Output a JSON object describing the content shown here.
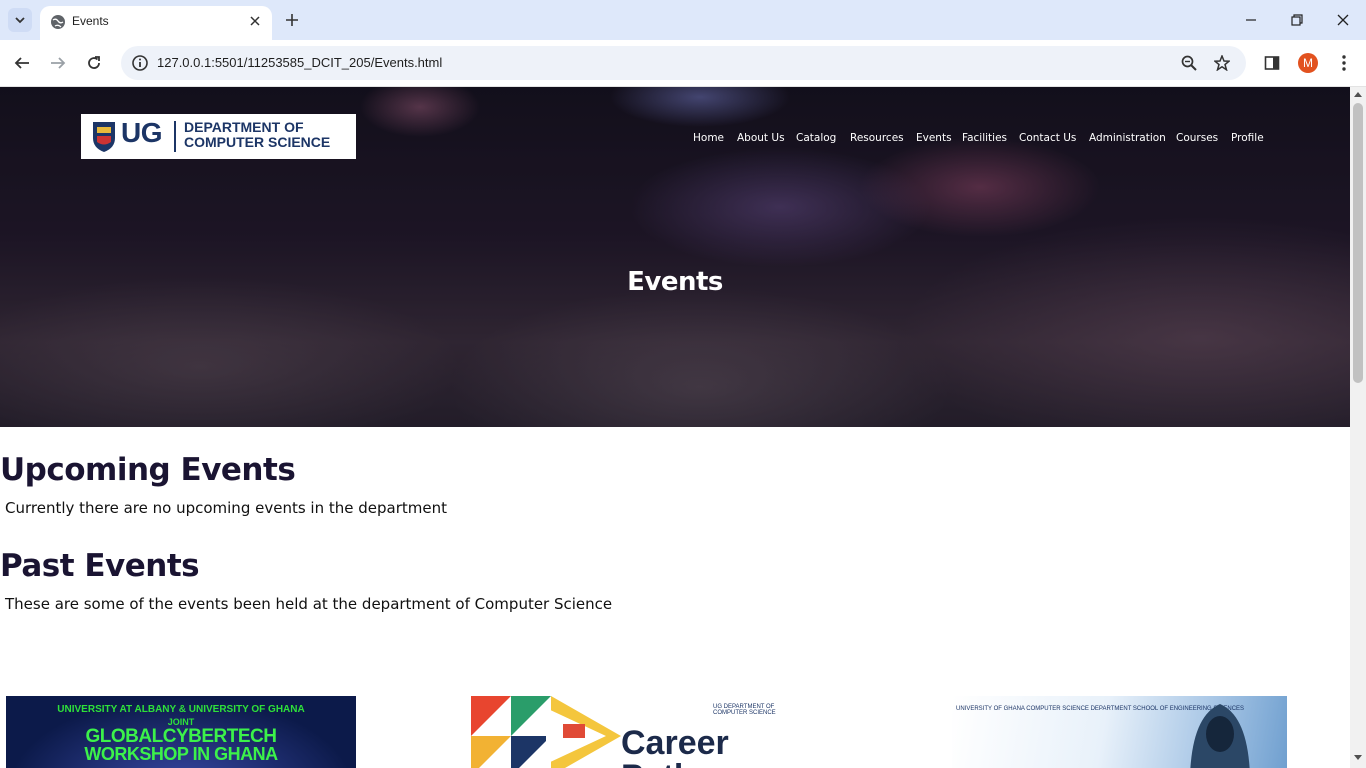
{
  "browser": {
    "tab_title": "Events",
    "url": "127.0.0.1:5501/11253585_DCIT_205/Events.html",
    "profile_initial": "M"
  },
  "site": {
    "logo": {
      "short": "UG",
      "line1": "DEPARTMENT OF",
      "line2": "COMPUTER SCIENCE"
    },
    "nav": [
      "Home",
      "About Us",
      "Catalog",
      "Resources",
      "Events",
      "Facilities",
      "Contact Us",
      "Administration",
      "Courses",
      "Profile"
    ],
    "hero_title": "Events"
  },
  "content": {
    "upcoming_heading": "Upcoming Events",
    "upcoming_text": "Currently there are no upcoming events in the department",
    "past_heading": "Past Events",
    "past_text": "These are some of the events been held at the department of Computer Science"
  },
  "cards": {
    "card1": {
      "top": "UNIVERSITY AT ALBANY  &  UNIVERSITY OF GHANA",
      "mid": "JOINT",
      "big1": "GLOBALCYBERTECH",
      "big2": "WORKSHOP IN GHANA"
    },
    "card2": {
      "logo": "UG  DEPARTMENT OF COMPUTER SCIENCE",
      "big": "Career Path"
    },
    "card3": {
      "logos": "UNIVERSITY OF GHANA   COMPUTER SCIENCE DEPARTMENT   SCHOOL OF ENGINEERING SCIENCES"
    }
  }
}
